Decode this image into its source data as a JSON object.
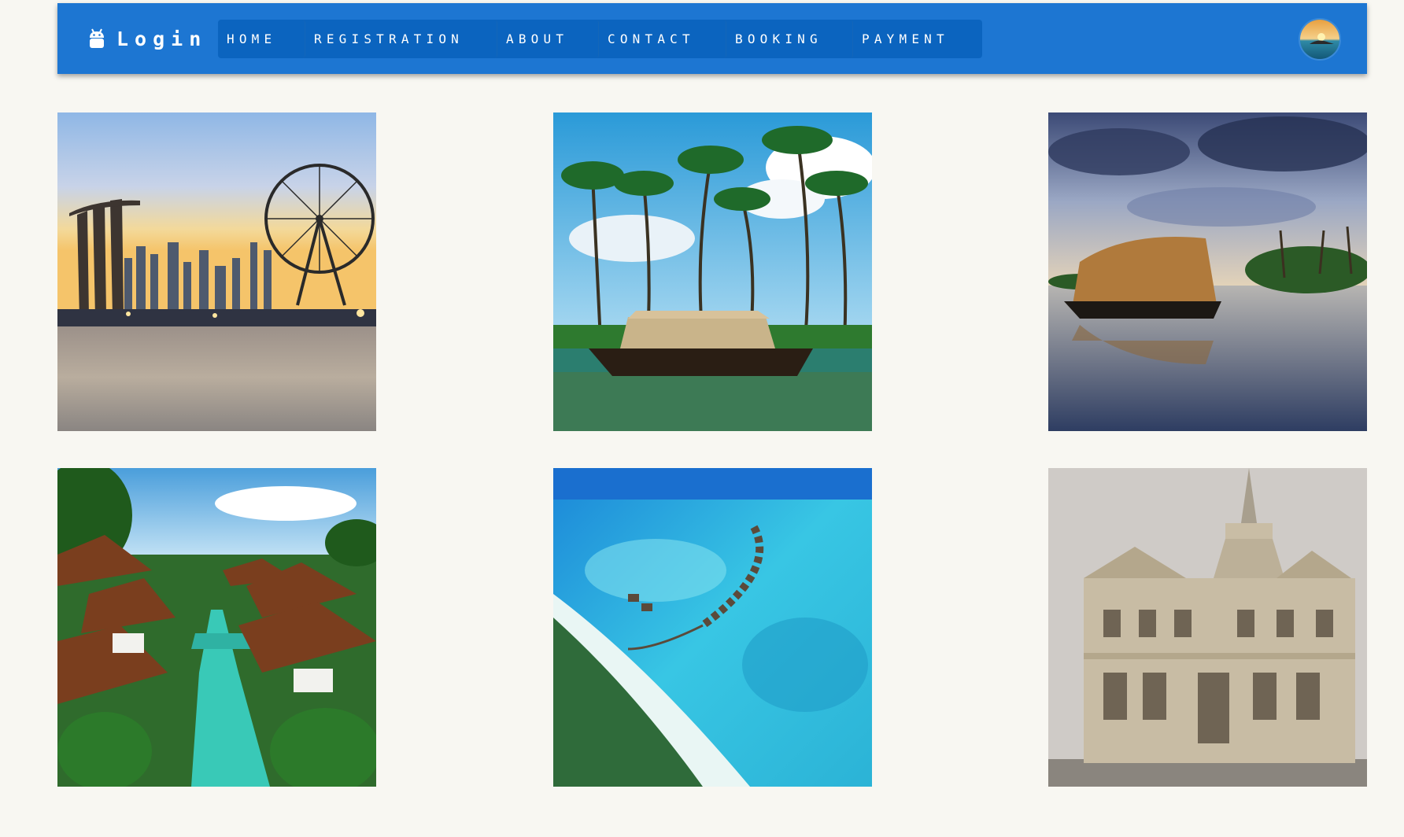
{
  "navbar": {
    "brand": {
      "label": "Login",
      "icon": "android-icon"
    },
    "menu": [
      {
        "label": "HOME"
      },
      {
        "label": "REGISTRATION"
      },
      {
        "label": "ABOUT"
      },
      {
        "label": "CONTACT"
      },
      {
        "label": "BOOKING"
      },
      {
        "label": "PAYMENT"
      }
    ],
    "avatar_icon": "profile-avatar"
  },
  "colors": {
    "navbar": "#1d76d2",
    "menu": "#0b64bf",
    "page_background": "#f8f7f2"
  }
}
